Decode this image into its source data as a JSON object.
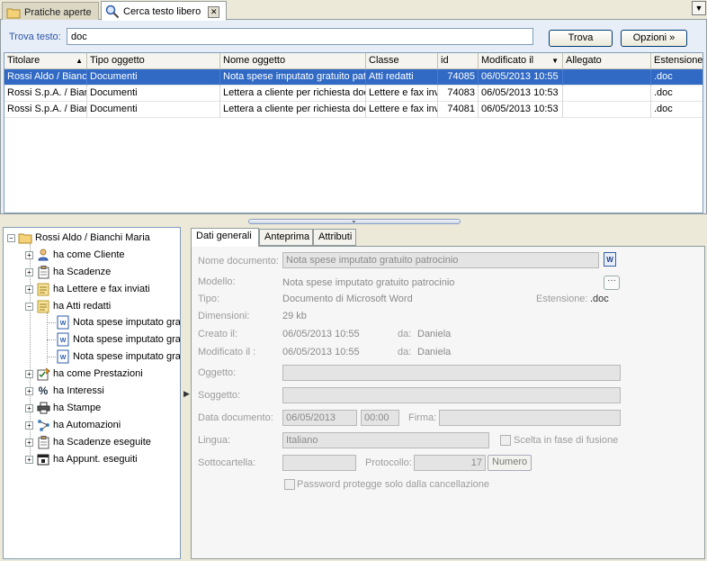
{
  "tabs": [
    {
      "label": "Pratiche aperte",
      "active": false
    },
    {
      "label": "Cerca testo libero",
      "active": true
    }
  ],
  "search": {
    "label": "Trova testo:",
    "value": "doc",
    "find_button": "Trova",
    "options_button": "Opzioni »"
  },
  "grid": {
    "columns": [
      "Titolare",
      "Tipo oggetto",
      "Nome oggetto",
      "Classe",
      "id",
      "Modificato il",
      "Allegato",
      "Estensione"
    ],
    "rows": [
      {
        "titolare": "Rossi Aldo / Bianc",
        "tipo": "Documenti",
        "nome": "Nota spese imputato gratuito patr",
        "classe": "Atti  redatti",
        "id": "74085",
        "modificato": "06/05/2013 10:55",
        "allegato": "",
        "estensione": ".doc",
        "selected": true
      },
      {
        "titolare": "Rossi S.p.A. / Bian",
        "tipo": "Documenti",
        "nome": "Lettera a cliente per richiesta doc",
        "classe": "Lettere e fax inv",
        "id": "74083",
        "modificato": "06/05/2013 10:53",
        "allegato": "",
        "estensione": ".doc",
        "selected": false
      },
      {
        "titolare": "Rossi S.p.A. / Bian",
        "tipo": "Documenti",
        "nome": "Lettera a cliente per richiesta doc",
        "classe": "Lettere e fax inv",
        "id": "74081",
        "modificato": "06/05/2013 10:53",
        "allegato": "",
        "estensione": ".doc",
        "selected": false
      }
    ]
  },
  "tree": {
    "root": "Rossi Aldo / Bianchi Maria",
    "items": [
      {
        "label": "ha come Cliente",
        "icon": "person-icon"
      },
      {
        "label": "ha Scadenze",
        "icon": "clipboard-icon"
      },
      {
        "label": "ha Lettere e fax inviati",
        "icon": "folder-doc-icon"
      },
      {
        "label": "ha Atti  redatti",
        "icon": "folder-doc-icon"
      },
      {
        "label": "Nota spese imputato grat",
        "icon": "word-doc-icon"
      },
      {
        "label": "Nota spese imputato grat",
        "icon": "word-doc-icon"
      },
      {
        "label": "Nota spese imputato grat",
        "icon": "word-doc-icon"
      },
      {
        "label": "ha come Prestazioni",
        "icon": "checklist-icon"
      },
      {
        "label": "ha Interessi",
        "icon": "percent-icon"
      },
      {
        "label": "ha Stampe",
        "icon": "printer-icon"
      },
      {
        "label": "ha Automazioni",
        "icon": "network-icon"
      },
      {
        "label": "ha Scadenze eseguite",
        "icon": "clipboard-icon"
      },
      {
        "label": "ha Appunt. eseguiti",
        "icon": "calendar-icon"
      }
    ]
  },
  "detail": {
    "tabs": [
      "Dati generali",
      "Anteprima",
      "Attributi"
    ],
    "labels": {
      "nome_documento": "Nome documento:",
      "modello": "Modello:",
      "tipo": "Tipo:",
      "estensione": "Estensione:",
      "dimensioni": "Dimensioni:",
      "creato": "Creato il:",
      "modificato": "Modificato il :",
      "da": "da:",
      "oggetto": "Oggetto:",
      "soggetto": "Soggetto:",
      "data_documento": "Data documento:",
      "firma": "Firma:",
      "lingua": "Lingua:",
      "scelta_fusione": "Scelta in fase di fusione",
      "sottocartella": "Sottocartella:",
      "protocollo": "Protocollo:",
      "numero_button": "Numero",
      "password": "Password protegge solo dalla cancellazione"
    },
    "values": {
      "nome_documento": "Nota spese imputato gratuito patrocinio",
      "modello": "Nota spese imputato gratuito patrocinio",
      "tipo": "Documento di Microsoft Word",
      "estensione": ".doc",
      "dimensioni": "29 kb",
      "creato_data": "06/05/2013 10:55",
      "creato_da": "Daniela",
      "modificato_data": "06/05/2013 10:55",
      "modificato_da": "Daniela",
      "oggetto": "",
      "soggetto": "",
      "data_documento": "06/05/2013",
      "ora_documento": "00:00",
      "firma": "",
      "lingua": "Italiano",
      "sottocartella": "",
      "protocollo": "17"
    }
  }
}
